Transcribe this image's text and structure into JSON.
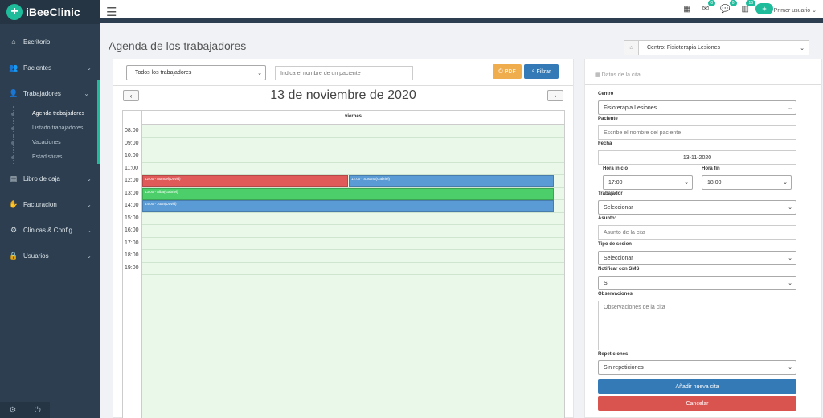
{
  "brand": {
    "name": "iBeeClinic"
  },
  "sidebar": {
    "items": [
      {
        "label": "Escritorio",
        "icon": "home-icon"
      },
      {
        "label": "Pacientes",
        "icon": "users-icon"
      },
      {
        "label": "Trabajadores",
        "icon": "user-tie-icon"
      },
      {
        "label": "Libro de caja",
        "icon": "money-icon"
      },
      {
        "label": "Facturacion",
        "icon": "handshake-icon"
      },
      {
        "label": "Clinicas & Config",
        "icon": "gears-icon"
      },
      {
        "label": "Usuarios",
        "icon": "lock-icon"
      }
    ],
    "subitems": [
      {
        "label": "Agenda trabajadores"
      },
      {
        "label": "Listado trabajadores"
      },
      {
        "label": "Vacaciones"
      },
      {
        "label": "Estadisticas"
      }
    ]
  },
  "topbar": {
    "badges": [
      "0",
      "0",
      "16"
    ],
    "user_label": "Primer usuario"
  },
  "page": {
    "title": "Agenda de los trabajadores"
  },
  "center_select": {
    "value": "Centro: Fisioterapia Lesiones"
  },
  "calendar": {
    "worker_filter": "Todos los trabajadores",
    "patient_placeholder": "Indica el nombre de un paciente",
    "pdf_label": "PDF",
    "filter_label": "Filtrar",
    "date": "13 de noviembre de 2020",
    "day_header": "viernes",
    "hours": [
      "08:00",
      "09:00",
      "10:00",
      "11:00",
      "12:00",
      "13:00",
      "14:00",
      "15:00",
      "16:00",
      "17:00",
      "18:00",
      "19:00"
    ],
    "events": [
      {
        "label": "12:00 - Manuel(David)",
        "color": "#e05a5a"
      },
      {
        "label": "12:00 - Susana(Gabriel)",
        "color": "#5b9bd5"
      },
      {
        "label": "13:00 - Alba(Gabriel)",
        "color": "#4ccf6a"
      },
      {
        "label": "14:00 - Juan(David)",
        "color": "#5b9bd5"
      }
    ]
  },
  "form": {
    "header": "Datos de la cita",
    "centro_label": "Centro",
    "centro_value": "Fisioterapia Lesiones",
    "paciente_label": "Paciente",
    "paciente_placeholder": "Escribe el nombre del paciente",
    "fecha_label": "Fecha",
    "fecha_value": "13-11-2020",
    "hora_inicio_label": "Hora inicio",
    "hora_inicio_value": "17:00",
    "hora_fin_label": "Hora fin",
    "hora_fin_value": "18:00",
    "trabajador_label": "Trabajador",
    "trabajador_value": "Seleccionar",
    "asunto_label": "Asunto:",
    "asunto_placeholder": "Asunto de la cita",
    "tipo_label": "Tipo de sesion",
    "tipo_value": "Seleccionar",
    "sms_label": "Notificar con SMS",
    "sms_value": "Si",
    "obs_label": "Observaciones",
    "obs_placeholder": "Observaciones de la cita",
    "rep_label": "Repeticiones",
    "rep_value": "Sin repeticiones",
    "add_label": "Añadir nueva cita",
    "cancel_label": "Cancelar"
  },
  "colors": {
    "accent": "#1fbc9c",
    "sidebar": "#2c3e50",
    "primary": "#337ab7",
    "danger": "#d9534f",
    "warning": "#f0ad4e"
  }
}
